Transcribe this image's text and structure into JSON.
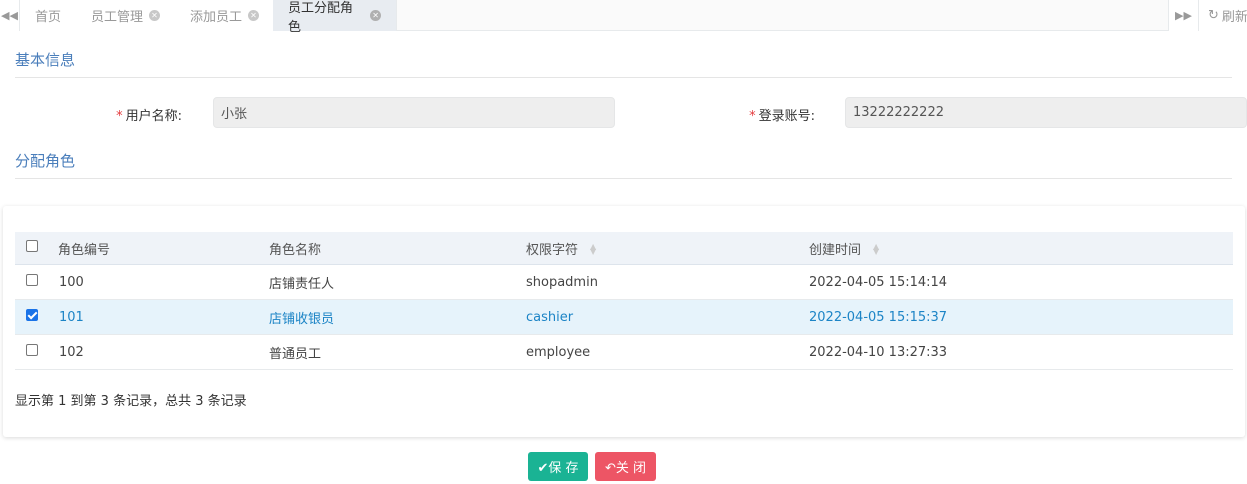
{
  "tabs": [
    {
      "label": "首页",
      "closable": false,
      "active": false
    },
    {
      "label": "员工管理",
      "closable": true,
      "active": false
    },
    {
      "label": "添加员工",
      "closable": true,
      "active": false
    },
    {
      "label": "员工分配角色",
      "closable": true,
      "active": true
    }
  ],
  "tabbar": {
    "refresh_label": "刷新",
    "left_icon": "double-chevron-left-icon",
    "right_icon": "double-chevron-right-icon",
    "refresh_icon": "refresh-icon"
  },
  "sections": {
    "basic": "基本信息",
    "roles": "分配角色"
  },
  "form": {
    "username_label": "用户名称:",
    "username_value": "小张",
    "account_label": "登录账号:",
    "account_value": "13222222222",
    "required_mark": "*"
  },
  "table": {
    "columns": [
      "角色编号",
      "角色名称",
      "权限字符",
      "创建时间"
    ],
    "rows": [
      {
        "id": "100",
        "name": "店铺责任人",
        "key": "shopadmin",
        "created": "2022-04-05 15:14:14",
        "checked": false
      },
      {
        "id": "101",
        "name": "店铺收银员",
        "key": "cashier",
        "created": "2022-04-05 15:15:37",
        "checked": true
      },
      {
        "id": "102",
        "name": "普通员工",
        "key": "employee",
        "created": "2022-04-10 13:27:33",
        "checked": false
      }
    ],
    "page_info": "显示第 1 到第 3 条记录，总共 3 条记录"
  },
  "buttons": {
    "save": "✔保 存",
    "close": "↶关 闭"
  },
  "colors": {
    "accent_blue": "#1c84c6",
    "save_green": "#1ab394",
    "close_red": "#ed5565",
    "section_blue": "#4a7ebb"
  }
}
